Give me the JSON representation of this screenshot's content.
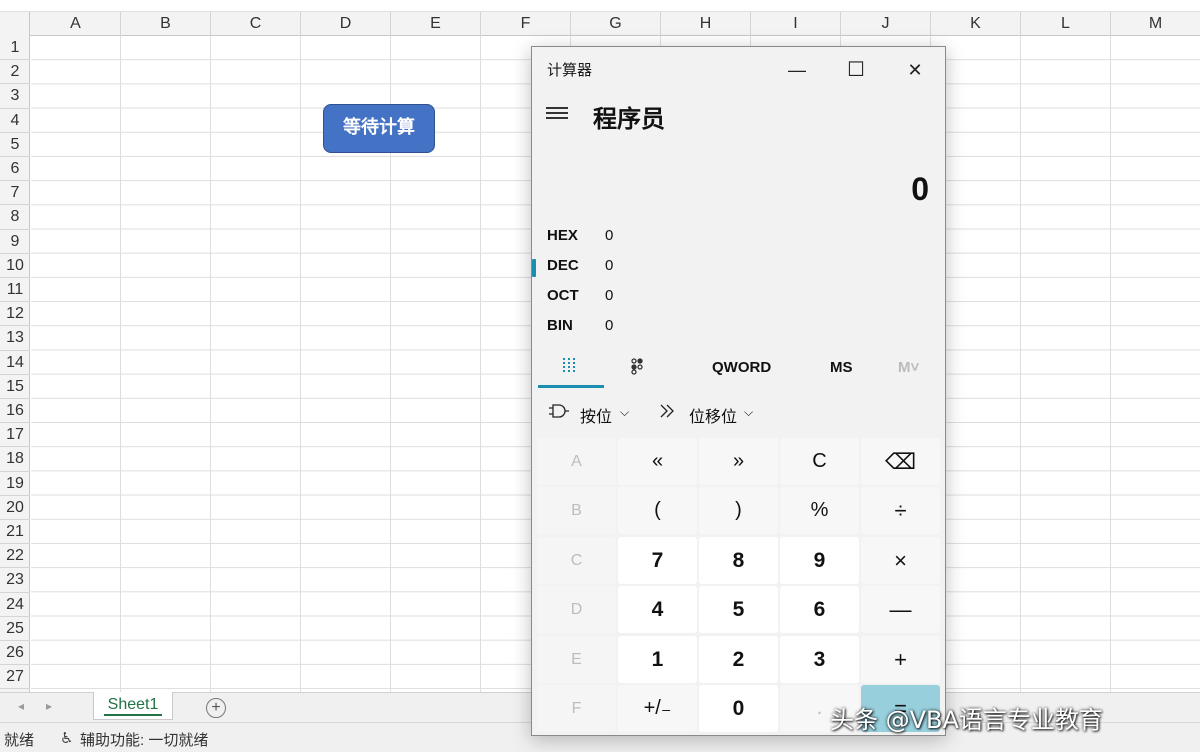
{
  "excel": {
    "columns": [
      "A",
      "B",
      "C",
      "D",
      "E",
      "F",
      "G",
      "H",
      "I",
      "J",
      "K",
      "L",
      "M"
    ],
    "rows": [
      "1",
      "2",
      "3",
      "4",
      "5",
      "6",
      "7",
      "8",
      "9",
      "10",
      "11",
      "12",
      "13",
      "14",
      "15",
      "16",
      "17",
      "18",
      "19",
      "20",
      "21",
      "22",
      "23",
      "24",
      "25",
      "26",
      "27"
    ],
    "shape_button_label": "等待计算",
    "sheet_tab": "Sheet1",
    "add_sheet": "+",
    "status_ready": "就绪",
    "status_accessibility": "辅助功能: 一切就绪"
  },
  "calculator": {
    "title": "计算器",
    "window": {
      "minimize": "—",
      "maximize": "☐",
      "close": "✕"
    },
    "mode": "程序员",
    "display": "0",
    "bases": [
      {
        "label": "HEX",
        "value": "0"
      },
      {
        "label": "DEC",
        "value": "0"
      },
      {
        "label": "OCT",
        "value": "0"
      },
      {
        "label": "BIN",
        "value": "0"
      }
    ],
    "toolbar": {
      "keypad_icon": "keypad-icon",
      "bits_icon": "bit-toggle-icon",
      "word_size": "QWORD",
      "ms": "MS",
      "mv": "M˅"
    },
    "bitwise": {
      "bitwise_label": "按位",
      "shift_label": "位移位",
      "chevron": "⌵"
    },
    "keys": [
      [
        "A",
        "«",
        "»",
        "C",
        "⌫"
      ],
      [
        "B",
        "(",
        ")",
        "%",
        "÷"
      ],
      [
        "C",
        "7",
        "8",
        "9",
        "×"
      ],
      [
        "D",
        "4",
        "5",
        "6",
        "—"
      ],
      [
        "E",
        "1",
        "2",
        "3",
        "+"
      ],
      [
        "F",
        "+/₋",
        "0",
        ".",
        "="
      ]
    ],
    "accent_color": "#1a8fb0"
  },
  "watermark": "头条 @VBA语言专业教育"
}
